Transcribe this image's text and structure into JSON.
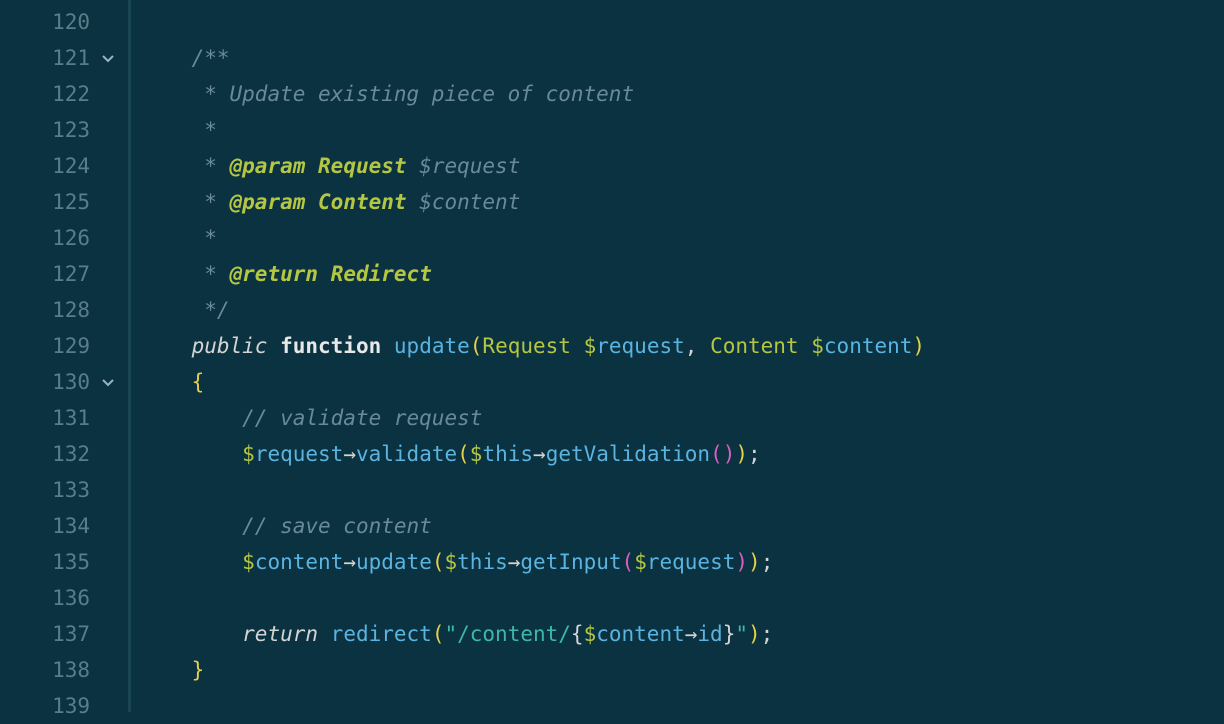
{
  "lines": [
    {
      "num": "120",
      "fold": false
    },
    {
      "num": "121",
      "fold": true
    },
    {
      "num": "122",
      "fold": false
    },
    {
      "num": "123",
      "fold": false
    },
    {
      "num": "124",
      "fold": false
    },
    {
      "num": "125",
      "fold": false
    },
    {
      "num": "126",
      "fold": false
    },
    {
      "num": "127",
      "fold": false
    },
    {
      "num": "128",
      "fold": false
    },
    {
      "num": "129",
      "fold": false
    },
    {
      "num": "130",
      "fold": true
    },
    {
      "num": "131",
      "fold": false
    },
    {
      "num": "132",
      "fold": false
    },
    {
      "num": "133",
      "fold": false
    },
    {
      "num": "134",
      "fold": false
    },
    {
      "num": "135",
      "fold": false
    },
    {
      "num": "136",
      "fold": false
    },
    {
      "num": "137",
      "fold": false
    },
    {
      "num": "138",
      "fold": false
    },
    {
      "num": "139",
      "fold": false
    }
  ],
  "code": {
    "l121_open": "/**",
    "l122_star": " * ",
    "l122_text": "Update existing piece of content",
    "l123_star": " *",
    "l124_star": " * ",
    "l124_tag": "@param",
    "l124_type": "Request",
    "l124_var": "$request",
    "l125_star": " * ",
    "l125_tag": "@param",
    "l125_type": "Content",
    "l125_var": "$content",
    "l126_star": " *",
    "l127_star": " * ",
    "l127_tag": "@return",
    "l127_type": "Redirect",
    "l128_close": " */",
    "l129_public": "public",
    "l129_function": "function",
    "l129_name": "update",
    "l129_type1": "Request",
    "l129_var1d": "$",
    "l129_var1": "request",
    "l129_comma": ",",
    "l129_type2": "Content",
    "l129_var2d": "$",
    "l129_var2": "content",
    "l130_brace": "{",
    "l131_comment": "// validate request",
    "l132_var1d": "$",
    "l132_var1": "request",
    "l132_arrow1": "→",
    "l132_method1": "validate",
    "l132_thisd": "$",
    "l132_this": "this",
    "l132_arrow2": "→",
    "l132_method2": "getValidation",
    "l132_semi": ";",
    "l134_comment": "// save content",
    "l135_var1d": "$",
    "l135_var1": "content",
    "l135_arrow1": "→",
    "l135_method1": "update",
    "l135_thisd": "$",
    "l135_this": "this",
    "l135_arrow2": "→",
    "l135_method2": "getInput",
    "l135_var2d": "$",
    "l135_var2": "request",
    "l135_semi": ";",
    "l137_return": "return",
    "l137_func": "redirect",
    "l137_str1": "\"/content/",
    "l137_interp_open": "{",
    "l137_vard": "$",
    "l137_var": "content",
    "l137_arrow": "→",
    "l137_prop": "id",
    "l137_interp_close": "}",
    "l137_str2": "\"",
    "l137_semi": ";",
    "l138_brace": "}"
  }
}
